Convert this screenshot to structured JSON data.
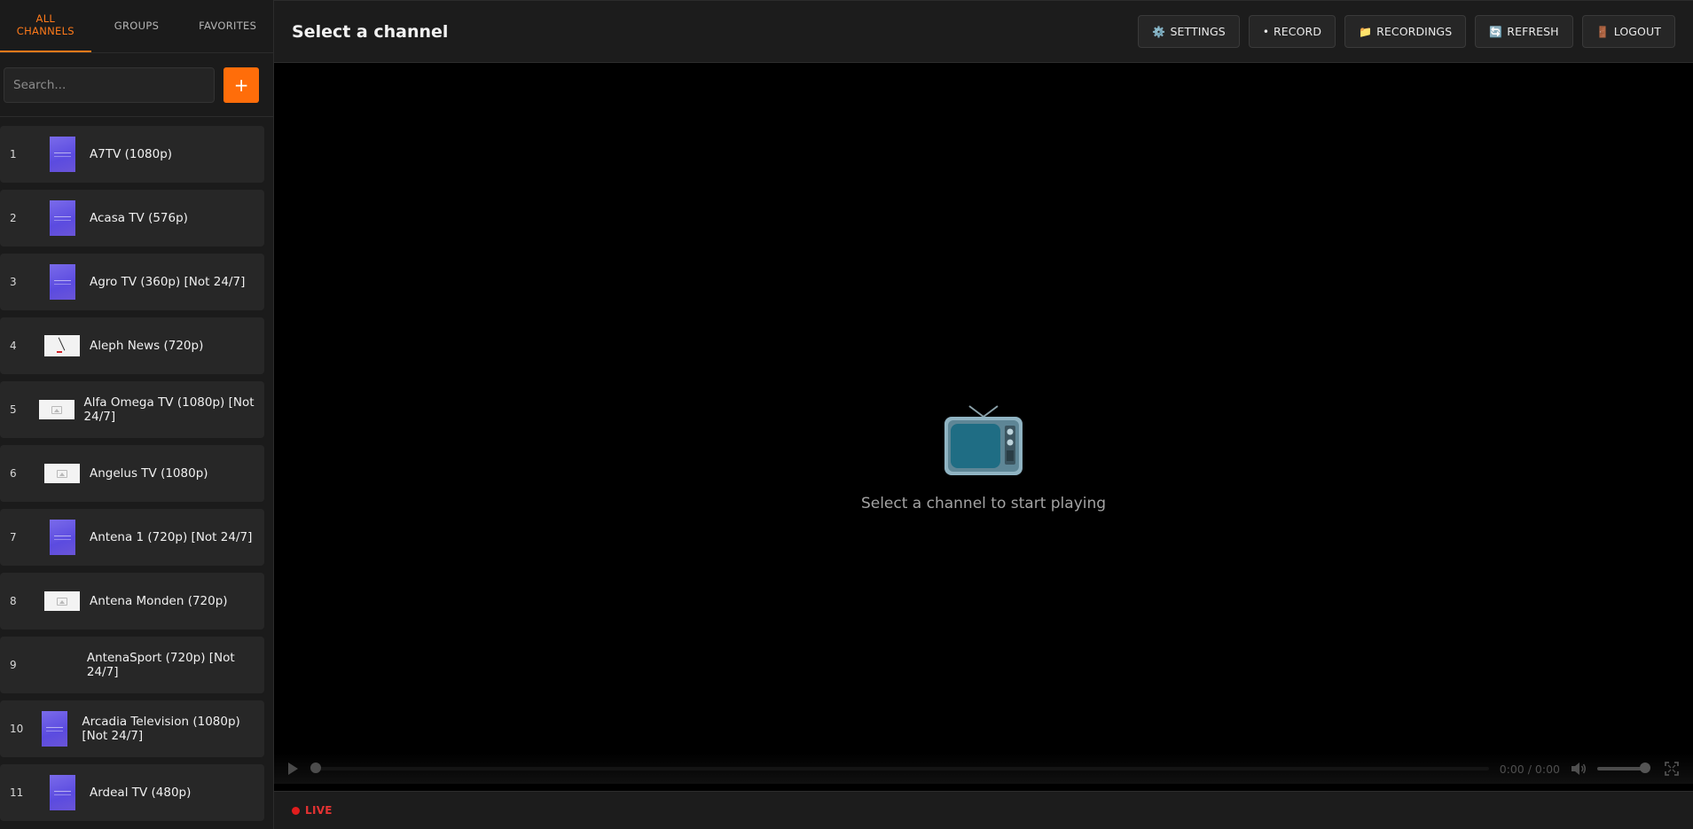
{
  "sidebar": {
    "tabs": [
      {
        "label": "ALL CHANNELS",
        "active": true
      },
      {
        "label": "GROUPS",
        "active": false
      },
      {
        "label": "FAVORITES",
        "active": false
      }
    ],
    "search": {
      "placeholder": "Search...",
      "value": ""
    },
    "add_label": "+",
    "channels": [
      {
        "number": "1",
        "name": "A7TV (1080p)",
        "logo": "purple-placeholder"
      },
      {
        "number": "2",
        "name": "Acasa TV (576p)",
        "logo": "purple-placeholder"
      },
      {
        "number": "3",
        "name": "Agro TV (360p) [Not 24/7]",
        "logo": "purple-placeholder"
      },
      {
        "number": "4",
        "name": "Aleph News (720p)",
        "logo": "aleph-logo"
      },
      {
        "number": "5",
        "name": "Alfa Omega TV (1080p) [Not 24/7]",
        "logo": "broken-image"
      },
      {
        "number": "6",
        "name": "Angelus TV (1080p)",
        "logo": "broken-image"
      },
      {
        "number": "7",
        "name": "Antena 1 (720p) [Not 24/7]",
        "logo": "purple-placeholder"
      },
      {
        "number": "8",
        "name": "Antena Monden (720p)",
        "logo": "broken-image"
      },
      {
        "number": "9",
        "name": "AntenaSport (720p) [Not 24/7]",
        "logo": "none"
      },
      {
        "number": "10",
        "name": "Arcadia Television (1080p) [Not 24/7]",
        "logo": "purple-placeholder"
      },
      {
        "number": "11",
        "name": "Ardeal TV (480p)",
        "logo": "purple-placeholder"
      }
    ]
  },
  "header": {
    "title": "Select a channel",
    "buttons": [
      {
        "icon": "gear-icon",
        "glyph": "⚙️",
        "label": "SETTINGS"
      },
      {
        "icon": "record-dot-icon",
        "glyph": "•",
        "label": "RECORD"
      },
      {
        "icon": "folder-icon",
        "glyph": "📁",
        "label": "RECORDINGS"
      },
      {
        "icon": "refresh-icon",
        "glyph": "🔄",
        "label": "REFRESH"
      },
      {
        "icon": "door-icon",
        "glyph": "🚪",
        "label": "LOGOUT"
      }
    ]
  },
  "player": {
    "placeholder_icon": "tv-icon",
    "placeholder_text": "Select a channel to start playing",
    "time": "0:00 / 0:00",
    "progress": 0,
    "volume": 1.0
  },
  "status": {
    "live_label": "LIVE"
  },
  "colors": {
    "accent": "#ff6d0a",
    "live": "#e11d1d",
    "sidebar_bg": "#1b1b1b",
    "item_bg": "#272727",
    "player_bg": "#000000"
  }
}
